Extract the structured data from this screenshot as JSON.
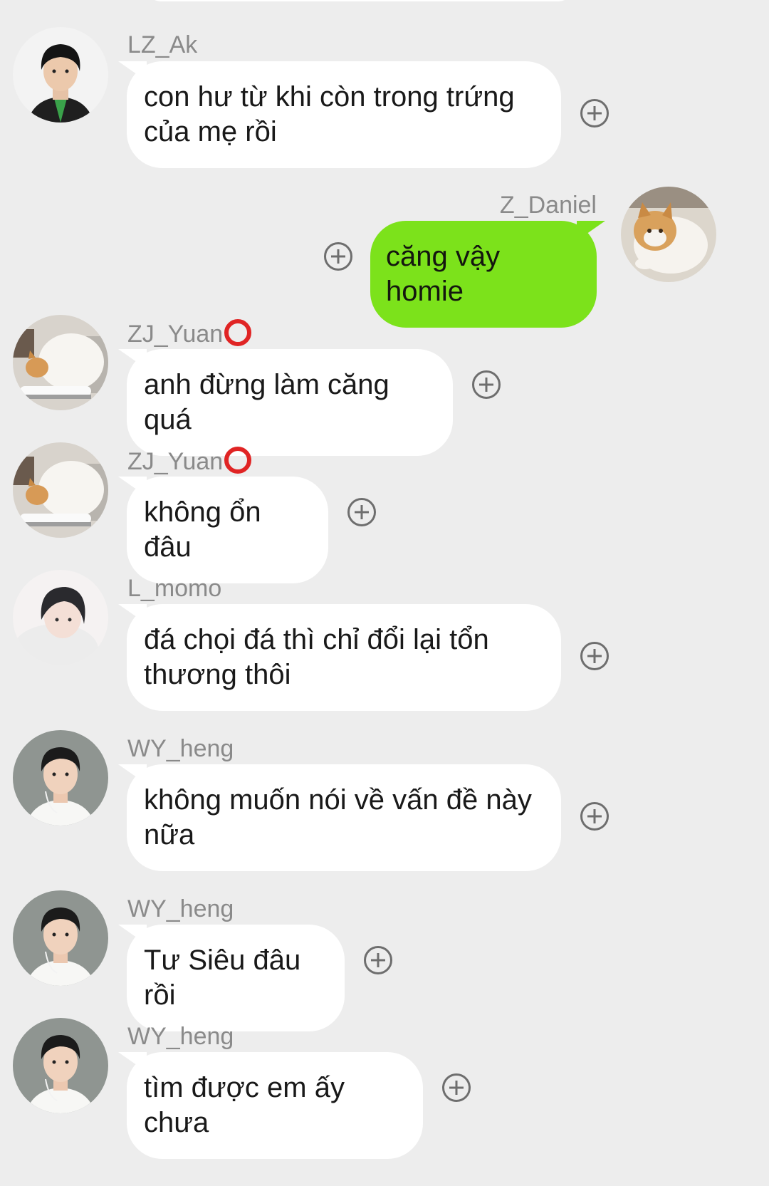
{
  "messages": [
    {
      "sender": "LZ_Ak",
      "text": "con hư từ khi còn trong trứng của mẹ rồi",
      "direction": "incoming",
      "avatar_icon": "person-green-jacket-avatar-icon"
    },
    {
      "sender": "Z_Daniel",
      "text": "căng vậy homie",
      "direction": "outgoing",
      "avatar_icon": "orange-white-cat-avatar-icon"
    },
    {
      "sender": "ZJ_Yuan",
      "status_icon": "red-ring-icon",
      "text": "anh đừng làm căng quá",
      "direction": "incoming",
      "avatar_icon": "white-cat-avatar-icon"
    },
    {
      "sender": "ZJ_Yuan",
      "status_icon": "red-ring-icon",
      "text": "không ổn đâu",
      "direction": "incoming",
      "avatar_icon": "white-cat-avatar-icon"
    },
    {
      "sender": "L_momo",
      "text": "đá chọi đá thì chỉ đổi lại tổn thương thôi",
      "direction": "incoming",
      "avatar_icon": "pale-boy-avatar-icon"
    },
    {
      "sender": "WY_heng",
      "text": "không muốn nói về vấn đề này nữa",
      "direction": "incoming",
      "avatar_icon": "dark-hair-boy-avatar-icon"
    },
    {
      "sender": "WY_heng",
      "text": "Tư Siêu đâu rồi",
      "direction": "incoming",
      "avatar_icon": "dark-hair-boy-avatar-icon"
    },
    {
      "sender": "WY_heng",
      "text": "tìm được em ấy chưa",
      "direction": "incoming",
      "avatar_icon": "dark-hair-boy-avatar-icon"
    }
  ],
  "colors": {
    "background": "#ededed",
    "incoming_bubble": "#ffffff",
    "outgoing_bubble": "#7ce21b",
    "sender_name": "#8a8a8a",
    "status_ring": "#e02424"
  }
}
